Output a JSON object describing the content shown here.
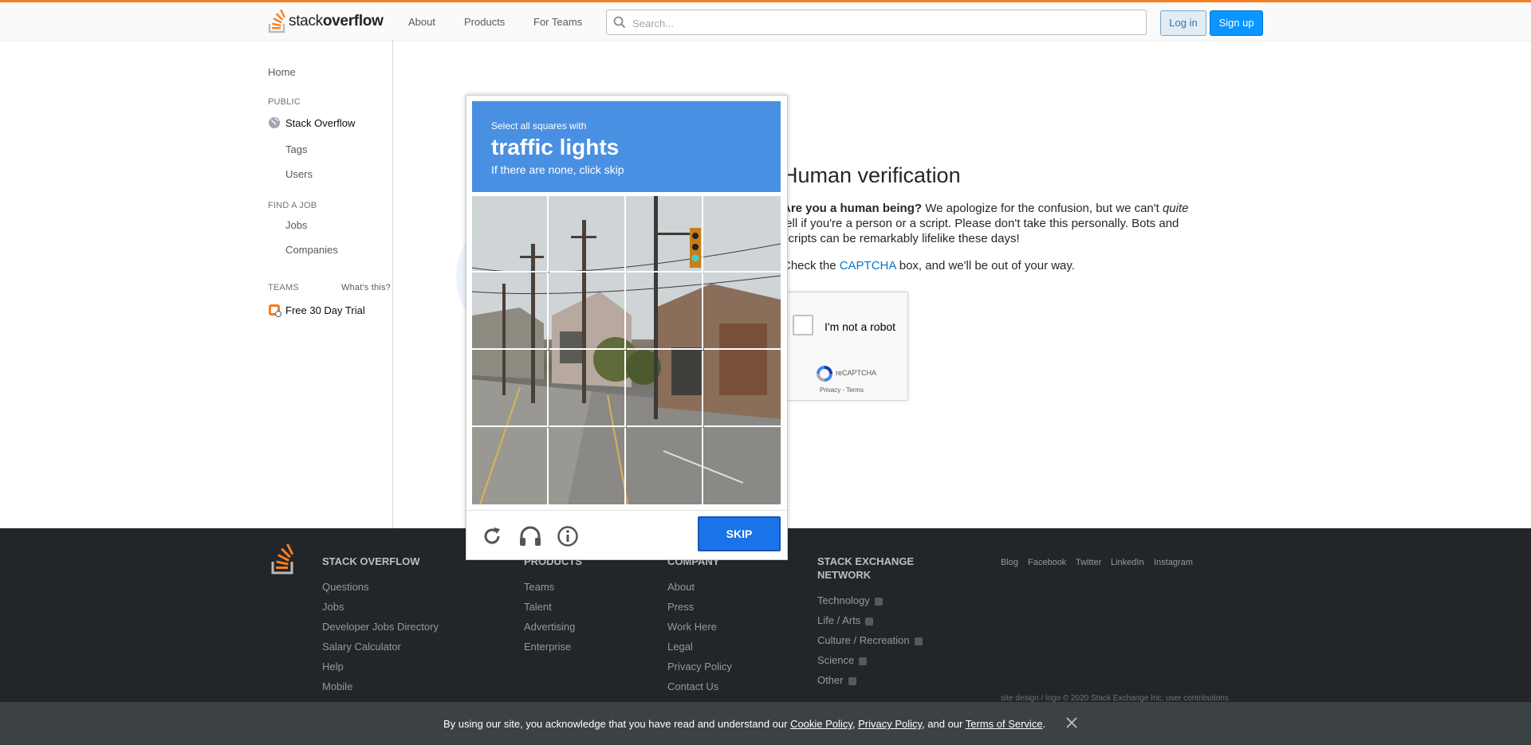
{
  "topbar": {
    "logo": {
      "text_light": "stack",
      "text_bold": "overflow"
    },
    "nav": [
      "About",
      "Products",
      "For Teams"
    ],
    "search": {
      "placeholder": "Search...",
      "value": ""
    },
    "login_label": "Log in",
    "signup_label": "Sign up",
    "accent_color": "#f48024"
  },
  "sidebar": {
    "home": "Home",
    "public_heading": "PUBLIC",
    "stack_overflow": "Stack Overflow",
    "tags": "Tags",
    "users": "Users",
    "find_job_heading": "FIND A JOB",
    "jobs": "Jobs",
    "companies": "Companies",
    "teams_heading": "TEAMS",
    "whats_this": "What's this?",
    "free_trial": "Free 30 Day Trial"
  },
  "main": {
    "title": "Human verification",
    "p1_bold": "Are you a human being?",
    "p1_a": " We apologize for the confusion, but we can't ",
    "p1_em": "quite",
    "p1_b": " tell if you're a person or a script. Please don't take this personally. Bots and scripts can be remarkably lifelike these days!",
    "p2_a": "Check the ",
    "p2_link": "CAPTCHA",
    "p2_b": " box, and we'll be out of your way.",
    "recaptcha": {
      "label": "I'm not a robot",
      "brand": "reCAPTCHA",
      "links": "Privacy - Terms",
      "checked": false
    }
  },
  "challenge": {
    "instruction_small": "Select all squares with",
    "instruction_big": "traffic lights",
    "instruction_note": "If there are none, click skip",
    "grid_rows": 4,
    "grid_cols": 4,
    "skip_label": "SKIP",
    "icons": [
      "reload-icon",
      "audio-icon",
      "info-icon"
    ],
    "header_color": "#4a90e2"
  },
  "footer": {
    "col1": {
      "heading": "STACK OVERFLOW",
      "links": [
        "Questions",
        "Jobs",
        "Developer Jobs Directory",
        "Salary Calculator",
        "Help",
        "Mobile"
      ]
    },
    "col2": {
      "heading": "PRODUCTS",
      "links": [
        "Teams",
        "Talent",
        "Advertising",
        "Enterprise"
      ]
    },
    "col3": {
      "heading": "COMPANY",
      "links": [
        "About",
        "Press",
        "Work Here",
        "Legal",
        "Privacy Policy",
        "Contact Us"
      ]
    },
    "col4": {
      "heading_line1": "STACK EXCHANGE",
      "heading_line2": "NETWORK",
      "links": [
        "Technology",
        "Life / Arts",
        "Culture / Recreation",
        "Science",
        "Other"
      ]
    },
    "social": [
      "Blog",
      "Facebook",
      "Twitter",
      "LinkedIn",
      "Instagram"
    ],
    "copyright": "site design / logo © 2020 Stack Exchange Inc; user contributions"
  },
  "cookie": {
    "text_a": "By using our site, you acknowledge that you have read and understand our ",
    "cookie_policy": "Cookie Policy",
    "sep1": ", ",
    "privacy_policy": "Privacy Policy",
    "sep2": ", and our ",
    "terms": "Terms of Service",
    "end": "."
  }
}
